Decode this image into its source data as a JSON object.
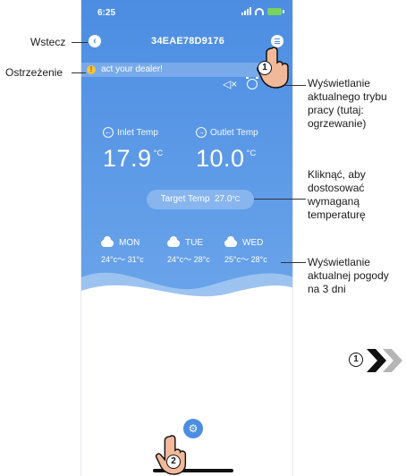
{
  "status_bar": {
    "time": "6:25"
  },
  "header": {
    "back_icon": "chevron-left-icon",
    "device_id": "34EAE78D9176",
    "menu_icon": "menu-icon"
  },
  "warning": {
    "icon": "warning-icon",
    "text": "act your dealer!"
  },
  "mode_icons": [
    "mute-icon",
    "alarm-clock-icon",
    "sun-icon"
  ],
  "temperatures": {
    "inlet": {
      "label": "Inlet Temp",
      "value": "17.9",
      "unit": "°C"
    },
    "outlet": {
      "label": "Outlet Temp",
      "value": "10.0",
      "unit": "°C"
    }
  },
  "target": {
    "label": "Target Temp",
    "value": "27.0",
    "unit": "°C"
  },
  "weather": [
    {
      "day": "MON",
      "range": "24°c～ 31°c"
    },
    {
      "day": "TUE",
      "range": "24°c～ 28°c"
    },
    {
      "day": "WED",
      "range": "25°c～ 28°c"
    }
  ],
  "callouts": {
    "back": "Wstecz",
    "warning": "Ostrzeżenie",
    "mode": "Wyświetlanie aktualnego trybu pracy (tutaj: ogrzewanie)",
    "target": "Kliknąć, aby dostosować wymaganą temperaturę",
    "weather": "Wyświetlanie aktualnej pogody na 3 dni"
  },
  "markers": {
    "hand1": "1",
    "hand2": "2",
    "next": "1"
  },
  "colors": {
    "primary": "#4c8de2",
    "warning": "#f5c33b"
  }
}
